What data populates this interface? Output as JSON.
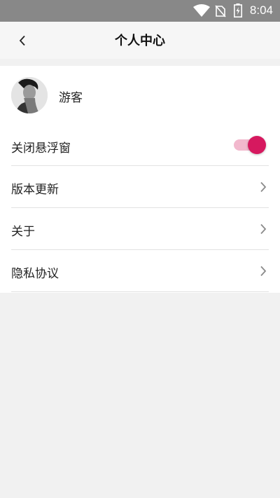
{
  "status_bar": {
    "time": "8:04",
    "icons": [
      "wifi-icon",
      "no-sim-icon",
      "battery-charging-icon"
    ]
  },
  "header": {
    "title": "个人中心",
    "back_icon": "chevron-left-icon"
  },
  "profile": {
    "username": "游客",
    "avatar_icon": "avatar-photo"
  },
  "settings": {
    "close_float": {
      "label": "关闭悬浮窗",
      "toggle_on": true
    },
    "version_update": {
      "label": "版本更新"
    },
    "about": {
      "label": "关于"
    },
    "privacy": {
      "label": "隐私协议"
    }
  },
  "colors": {
    "accent": "#d6195f",
    "accent_track": "#f2b8cd",
    "status_bar": "#888888",
    "page_bg": "#f1f1f1"
  }
}
